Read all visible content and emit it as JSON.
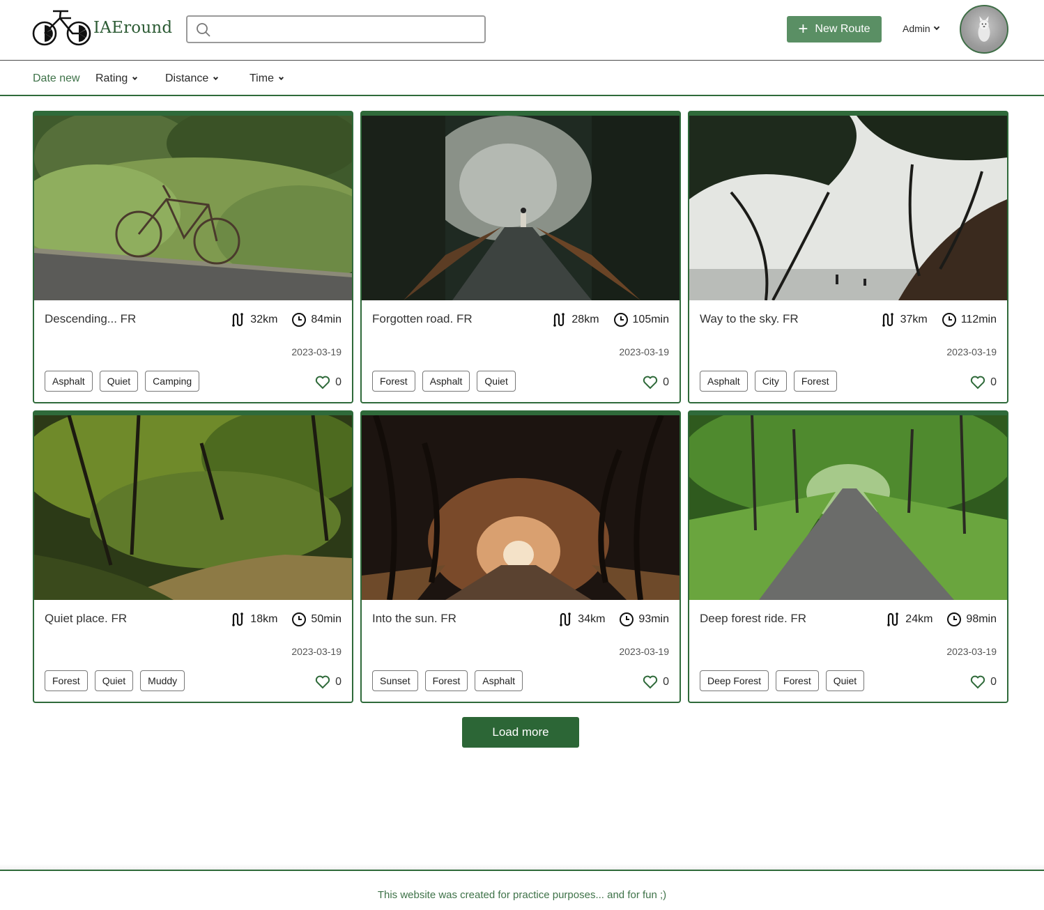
{
  "brand": {
    "name": "IAEround"
  },
  "search": {
    "placeholder": "",
    "value": ""
  },
  "header": {
    "new_route_label": "New Route",
    "user_label": "Admin"
  },
  "filters": [
    {
      "label": "Date new",
      "active": true
    },
    {
      "label": "Rating",
      "active": false
    },
    {
      "label": "Distance",
      "active": false
    },
    {
      "label": "Time",
      "active": false
    }
  ],
  "routes": [
    {
      "title": "Descending... FR",
      "distance": "32km",
      "time": "84min",
      "date": "2023-03-19",
      "tags": [
        "Asphalt",
        "Quiet",
        "Camping"
      ],
      "likes": "0",
      "image": "bike-leaning-on-roadside-bushes"
    },
    {
      "title": "Forgotten road. FR",
      "distance": "28km",
      "time": "105min",
      "date": "2023-03-19",
      "tags": [
        "Forest",
        "Asphalt",
        "Quiet"
      ],
      "likes": "0",
      "image": "cyclist-on-misty-forest-road"
    },
    {
      "title": "Way to the sky. FR",
      "distance": "37km",
      "time": "112min",
      "date": "2023-03-19",
      "tags": [
        "Asphalt",
        "City",
        "Forest"
      ],
      "likes": "0",
      "image": "cypress-trees-by-the-sea"
    },
    {
      "title": "Quiet place. FR",
      "distance": "18km",
      "time": "50min",
      "date": "2023-03-19",
      "tags": [
        "Forest",
        "Quiet",
        "Muddy"
      ],
      "likes": "0",
      "image": "sunlit-forest-path"
    },
    {
      "title": "Into the sun. FR",
      "distance": "34km",
      "time": "93min",
      "date": "2023-03-19",
      "tags": [
        "Sunset",
        "Forest",
        "Asphalt"
      ],
      "likes": "0",
      "image": "cypress-tree-tunnel-at-sunset"
    },
    {
      "title": "Deep forest ride. FR",
      "distance": "24km",
      "time": "98min",
      "date": "2023-03-19",
      "tags": [
        "Deep Forest",
        "Forest",
        "Quiet"
      ],
      "likes": "0",
      "image": "green-tree-lined-road"
    }
  ],
  "load_more_label": "Load more",
  "footer": {
    "text": "This website was created for practice purposes... and for fun ;)"
  },
  "colors": {
    "accent": "#2c6636",
    "accent_light": "#5a8f64",
    "border": "#2f6a3a"
  },
  "icons": [
    "bicycle-logo-icon",
    "search-icon",
    "plus-icon",
    "chevron-down-icon",
    "route-icon",
    "clock-icon",
    "heart-icon"
  ]
}
